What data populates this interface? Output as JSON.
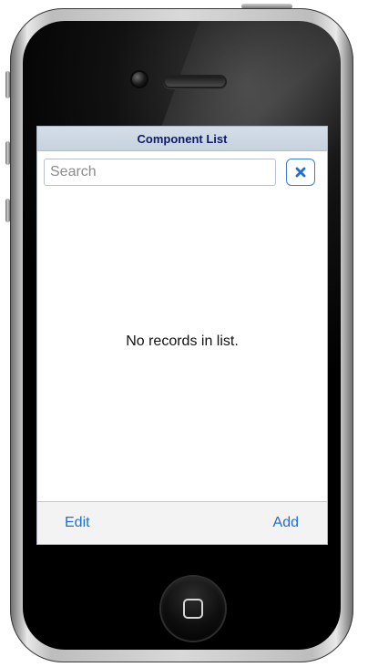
{
  "screen": {
    "title": "Component List",
    "search": {
      "placeholder": "Search",
      "value": ""
    },
    "clear_button": {
      "icon": "close-icon"
    },
    "empty_message": "No records in list.",
    "footer": {
      "edit_label": "Edit",
      "add_label": "Add"
    }
  },
  "colors": {
    "title_bar_background": "#c6d2de",
    "title_text": "#101a6b",
    "accent": "#1f6fd1"
  }
}
